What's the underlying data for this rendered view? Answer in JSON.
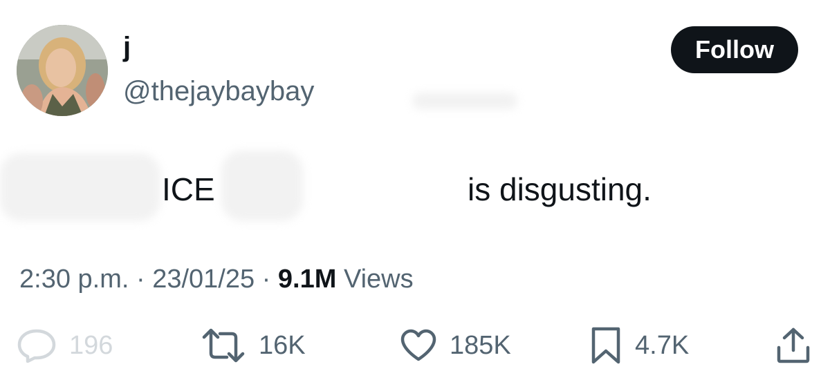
{
  "user": {
    "display_name": "j",
    "handle": "@thejaybaybay"
  },
  "follow_button": {
    "label": "Follow"
  },
  "tweet": {
    "text_part_1": "ICE",
    "text_part_2": "is disgusting."
  },
  "meta": {
    "time": "2:30 p.m.",
    "separator_1": " · ",
    "date": "23/01/25",
    "separator_2": " · ",
    "views_count": "9.1M",
    "views_label": " Views"
  },
  "actions": {
    "replies": {
      "icon": "reply-icon",
      "count": "196"
    },
    "reposts": {
      "icon": "repost-icon",
      "count": "16K"
    },
    "likes": {
      "icon": "heart-icon",
      "count": "185K"
    },
    "bookmarks": {
      "icon": "bookmark-icon",
      "count": "4.7K"
    },
    "share": {
      "icon": "share-icon"
    }
  },
  "colors": {
    "text_primary": "#0f1419",
    "text_secondary": "#536471",
    "follow_bg": "#0f1419",
    "faded": "#d3d8dc"
  }
}
